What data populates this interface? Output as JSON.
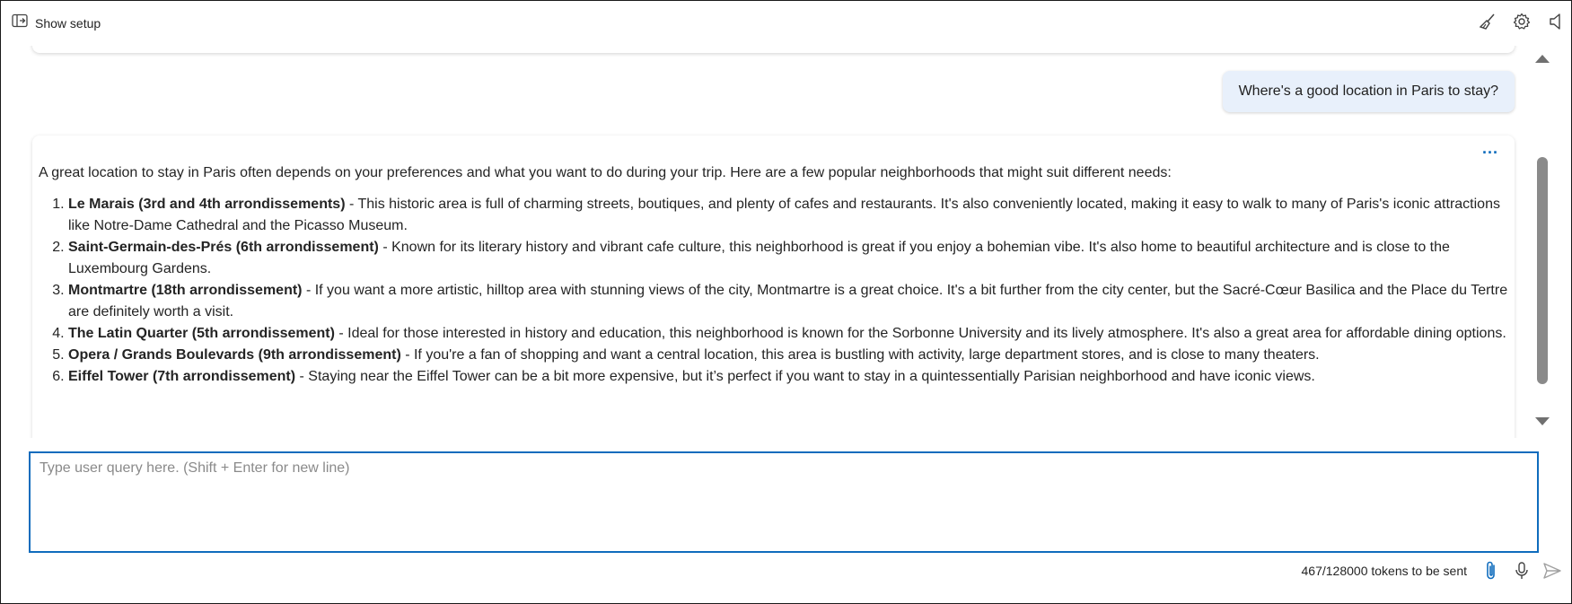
{
  "header": {
    "show_setup_label": "Show setup",
    "icons": [
      "broom-icon",
      "gear-icon",
      "speaker-icon"
    ]
  },
  "conversation": {
    "user_message": "Where's a good location in Paris to stay?",
    "assistant": {
      "more_label": "...",
      "intro": "A great location to stay in Paris often depends on your preferences and what you want to do during your trip. Here are a few popular neighborhoods that might suit different needs:",
      "items": [
        {
          "title": "Le Marais (3rd and 4th arrondissements)",
          "text": " - This historic area is full of charming streets, boutiques, and plenty of cafes and restaurants. It's also conveniently located, making it easy to walk to many of Paris's iconic attractions like Notre-Dame Cathedral and the Picasso Museum."
        },
        {
          "title": "Saint-Germain-des-Prés (6th arrondissement)",
          "text": " - Known for its literary history and vibrant cafe culture, this neighborhood is great if you enjoy a bohemian vibe. It's also home to beautiful architecture and is close to the Luxembourg Gardens."
        },
        {
          "title": "Montmartre (18th arrondissement)",
          "text": " - If you want a more artistic, hilltop area with stunning views of the city, Montmartre is a great choice. It's a bit further from the city center, but the Sacré-Cœur Basilica and the Place du Tertre are definitely worth a visit."
        },
        {
          "title": "The Latin Quarter (5th arrondissement)",
          "text": " - Ideal for those interested in history and education, this neighborhood is known for the Sorbonne University and its lively atmosphere. It's also a great area for affordable dining options."
        },
        {
          "title": "Opera / Grands Boulevards (9th arrondissement)",
          "text": " - If you're a fan of shopping and want a central location, this area is bustling with activity, large department stores, and is close to many theaters."
        },
        {
          "title": "Eiffel Tower (7th arrondissement)",
          "text": " - Staying near the Eiffel Tower can be a bit more expensive, but it’s perfect if you want to stay in a quintessentially Parisian neighborhood and have iconic views."
        }
      ]
    }
  },
  "input": {
    "placeholder": "Type user query here. (Shift + Enter for new line)",
    "value": ""
  },
  "footer": {
    "token_count": "467/128000 tokens to be sent",
    "icons": [
      "paperclip-icon",
      "microphone-icon",
      "send-icon"
    ]
  },
  "colors": {
    "accent": "#0f6cbd",
    "user_bubble": "#e8f0fb"
  }
}
